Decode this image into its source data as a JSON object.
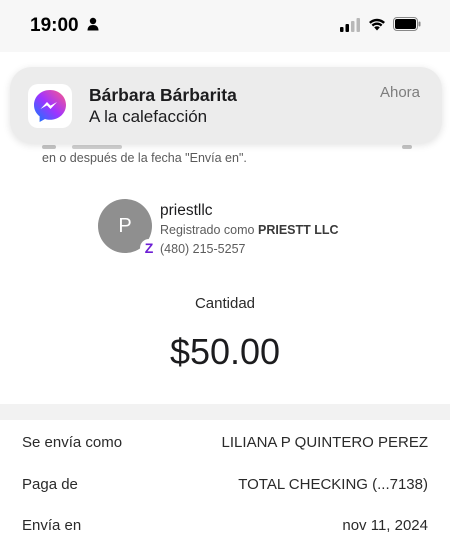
{
  "status_bar": {
    "time": "19:00"
  },
  "notification": {
    "app_icon": "messenger-icon",
    "sender": "Bárbara Bárbarita",
    "message": "A la calefacción",
    "time": "Ahora"
  },
  "disclaimer": {
    "text": "en o después de la fecha \"Envía en\"."
  },
  "recipient": {
    "initial": "P",
    "name": "priestllc",
    "registered_prefix": "Registrado como",
    "registered_name": "PRIESTT LLC",
    "phone": "(480) 215-5257",
    "badge_icon": "zelle-icon",
    "badge_letter": "Z"
  },
  "amount": {
    "label": "Cantidad",
    "value": "$50.00"
  },
  "details": [
    {
      "label": "Se envía como",
      "value": "LILIANA P QUINTERO PEREZ"
    },
    {
      "label": "Paga de",
      "value": "TOTAL CHECKING (...7138)"
    },
    {
      "label": "Envía en",
      "value": "nov 11, 2024"
    }
  ],
  "colors": {
    "zelle_purple": "#6d1ed4",
    "avatar_gray": "#8f8f8f",
    "notification_bg": "#ececec"
  }
}
